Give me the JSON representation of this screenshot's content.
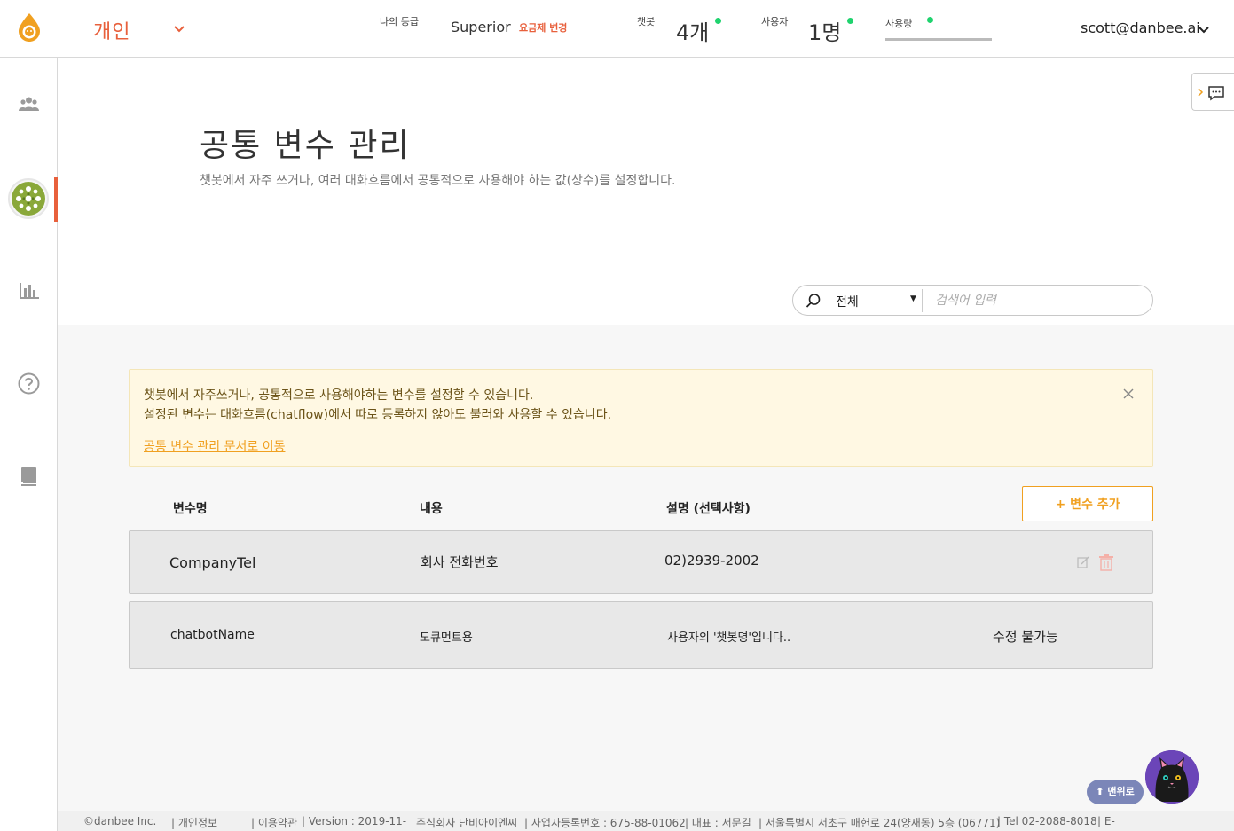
{
  "header": {
    "workspace": "개인",
    "grade_label": "나의 등급",
    "grade_value": "Superior",
    "plan_change": "요금제 변경",
    "chatbot_label": "챗봇",
    "chatbot_count": "4개",
    "users_label": "사용자",
    "users_count": "1명",
    "usage_label": "사용량",
    "user_email": "scott@danbee.ai",
    "status_color": "#1fd36e",
    "accent_color": "#e8603c"
  },
  "sidebar": {
    "items": [
      {
        "icon": "people-icon"
      },
      {
        "icon": "chatbot-avatar"
      },
      {
        "icon": "bar-chart-icon"
      },
      {
        "icon": "help-icon"
      },
      {
        "icon": "book-icon"
      }
    ]
  },
  "page": {
    "title": "공통 변수 관리",
    "description": "챗봇에서 자주 쓰거나, 여러 대화흐름에서 공통적으로 사용해야 하는 값(상수)를 설정합니다."
  },
  "search": {
    "scope": "전체",
    "placeholder": "검색어 입력"
  },
  "notice": {
    "line1": "챗봇에서 자주쓰거나, 공통적으로 사용해야하는 변수를 설정할 수 있습니다.",
    "line2": "설정된 변수는 대화흐름(chatflow)에서 따로 등록하지 않아도 불러와 사용할 수 있습니다.",
    "link": "공통 변수 관리 문서로 이동"
  },
  "table": {
    "columns": [
      "변수명",
      "내용",
      "설명 (선택사항)"
    ],
    "add_button": "+ 변수 추가",
    "rows": [
      {
        "name": "CompanyTel",
        "content": "회사 전화번호",
        "desc": "02)2939-2002",
        "status": ""
      },
      {
        "name": "chatbotName",
        "content": "도큐먼트용",
        "desc": "사용자의 '챗봇명'입니다..",
        "status": "수정 불가능"
      }
    ]
  },
  "footer": {
    "copyright": "©danbee Inc.",
    "privacy": "개인정보",
    "terms": "이용약관",
    "version": "Version : 2019-11-",
    "company": "주식회사 단비아이엔씨",
    "bizno": "사업자등록번호 : 675-88-01062",
    "ceo": "대표 : 서문길",
    "address": "서울특별시 서초구 매헌로 24(양재동) 5층 (06771)",
    "tel": "Tel 02-2088-8018",
    "email": "E-"
  },
  "floating": {
    "top_button": "⬆ 맨위로"
  }
}
